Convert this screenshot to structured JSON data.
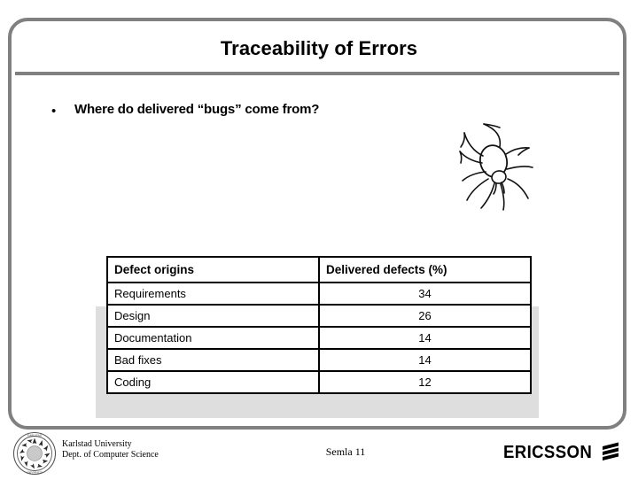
{
  "slide": {
    "title": "Traceability of Errors",
    "bullet_marker": "•",
    "bullet_text": "Where do delivered “bugs” come from?"
  },
  "table": {
    "headers": [
      "Defect origins",
      "Delivered defects (%)"
    ],
    "rows": [
      {
        "origin": "Requirements",
        "value": "34"
      },
      {
        "origin": "Design",
        "value": "26"
      },
      {
        "origin": "Documentation",
        "value": "14"
      },
      {
        "origin": "Bad fixes",
        "value": "14"
      },
      {
        "origin": "Coding",
        "value": "12"
      }
    ]
  },
  "footer": {
    "org_line1": "Karlstad University",
    "org_line2": "Dept. of Computer Science",
    "center_label": "Semla 11",
    "brand": "ERICSSON"
  },
  "chart_data": {
    "type": "table",
    "title": "Traceability of Errors",
    "categories": [
      "Requirements",
      "Design",
      "Documentation",
      "Bad fixes",
      "Coding"
    ],
    "values": [
      34,
      26,
      14,
      14,
      12
    ],
    "xlabel": "Defect origins",
    "ylabel": "Delivered defects (%)",
    "ylim": [
      0,
      100
    ]
  },
  "colors": {
    "frame": "#808080",
    "rule": "#808080",
    "table_border": "#000000",
    "table_shadow": "#dedede",
    "text": "#000000"
  }
}
